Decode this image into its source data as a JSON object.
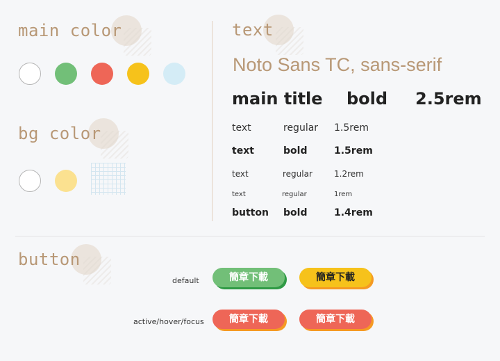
{
  "colors": {
    "white": "#ffffff",
    "green": "#72bf78",
    "red": "#ee6657",
    "yellow": "#f6c21b",
    "light_blue": "#d4ecf6",
    "pale_yellow": "#fbe190",
    "tan": "#b89876",
    "dark_green": "#2f9a45",
    "orange": "#f59a23"
  },
  "main_color": {
    "title": "main color"
  },
  "bg_color": {
    "title": "bg color"
  },
  "text_section": {
    "title": "text",
    "font_family": "Noto Sans TC, sans-serif",
    "rows": [
      {
        "name": "main title",
        "weight": "bold",
        "size": "2.5rem"
      },
      {
        "name": "text",
        "weight": "regular",
        "size": "1.5rem"
      },
      {
        "name": "text",
        "weight": "bold",
        "size": "1.5rem"
      },
      {
        "name": "text",
        "weight": "regular",
        "size": "1.2rem"
      },
      {
        "name": "text",
        "weight": "regular",
        "size": "1rem"
      },
      {
        "name": "button",
        "weight": "bold",
        "size": "1.4rem"
      }
    ]
  },
  "button_section": {
    "title": "button",
    "default_label": "default",
    "active_label": "active/hover/focus",
    "button_text": "簡章下載"
  }
}
